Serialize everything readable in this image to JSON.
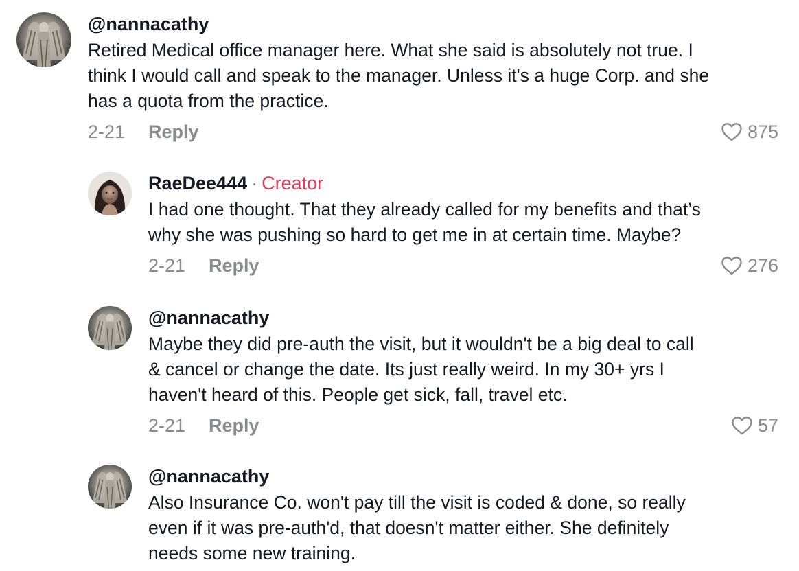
{
  "comments": [
    {
      "username": "@nannacathy",
      "text": "Retired Medical office manager here. What she said is absolutely not true. I\nthink I would call and speak to the manager. Unless it's a huge Corp. and she\nhas a quota from the practice.",
      "date": "2-21",
      "reply_label": "Reply",
      "likes": "875"
    },
    {
      "username": "RaeDee444",
      "separator": "·",
      "badge": "Creator",
      "text": "I had one thought. That they already called for my benefits and that’s\nwhy she was pushing so hard to get me in at certain time. Maybe?",
      "date": "2-21",
      "reply_label": "Reply",
      "likes": "276"
    },
    {
      "username": "@nannacathy",
      "text": "Maybe they did pre-auth the visit, but it wouldn't be a big deal to call\n& cancel or change the date. Its just really weird. In my 30+ yrs I\nhaven't heard of this. People get sick, fall, travel etc.",
      "date": "2-21",
      "reply_label": "Reply",
      "likes": "57"
    },
    {
      "username": "@nannacathy",
      "text": "Also Insurance Co. won't pay till the visit is coded & done, so really\neven if it was pre-auth'd, that doesn't matter either. She definitely\nneeds some new training."
    }
  ],
  "colors": {
    "text": "#161823",
    "muted": "#8a8b91",
    "creator": "#e13b5b"
  },
  "icons": {
    "like": "heart-outline-icon",
    "avatar_user": "angel-statue-avatar",
    "avatar_creator": "woman-portrait-avatar"
  }
}
